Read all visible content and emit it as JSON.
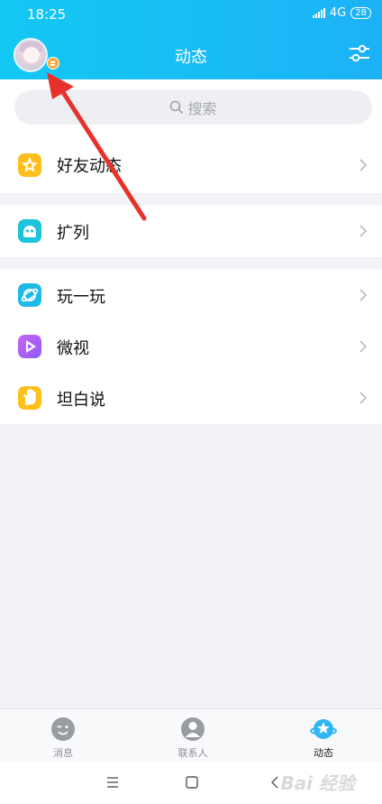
{
  "status_bar": {
    "time": "18:25",
    "network": "4G",
    "battery": "28"
  },
  "header": {
    "title": "动态"
  },
  "search": {
    "placeholder": "搜索"
  },
  "menu": {
    "group1": [
      {
        "label": "好友动态",
        "icon": "friends-feed-star-icon",
        "color": "#ffbf1a"
      }
    ],
    "group2": [
      {
        "label": "扩列",
        "icon": "expand-list-icon",
        "color": "#1cc3da"
      }
    ],
    "group3": [
      {
        "label": "玩一玩",
        "icon": "play-planet-icon",
        "color": "#1fb9e8"
      },
      {
        "label": "微视",
        "icon": "weishi-play-icon",
        "color": "#a05ef4"
      },
      {
        "label": "坦白说",
        "icon": "hand-icon",
        "color": "#ffbf1a"
      }
    ]
  },
  "tabbar": {
    "tabs": [
      {
        "label": "消息",
        "icon": "message-icon"
      },
      {
        "label": "联系人",
        "icon": "contacts-icon"
      },
      {
        "label": "动态",
        "icon": "feed-planet-icon",
        "active": true
      }
    ]
  },
  "watermark": "Bai 经验",
  "annotation": {
    "type": "red-arrow",
    "color": "#e8312b"
  }
}
